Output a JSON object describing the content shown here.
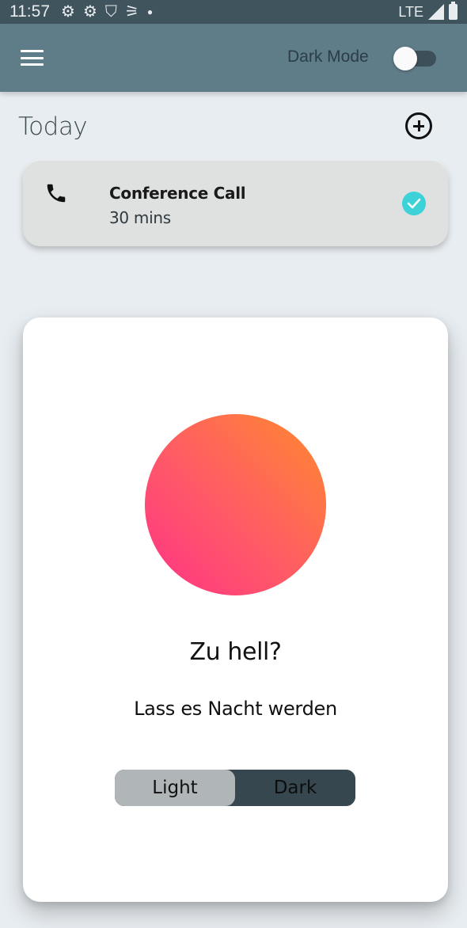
{
  "status_bar": {
    "time": "11:57",
    "icons": [
      "gear-icon",
      "gear-icon",
      "shield-icon",
      "satellite-icon",
      "dot-icon"
    ],
    "network": "LTE"
  },
  "app_bar": {
    "dark_mode_label": "Dark Mode",
    "dark_mode_enabled": false
  },
  "today": {
    "title": "Today"
  },
  "tasks": [
    {
      "title": "Conference Call",
      "duration": "30 mins",
      "icon": "phone-icon",
      "done": true
    }
  ],
  "dialog": {
    "title": "Zu hell?",
    "subtitle": "Lass es Nacht werden",
    "options": [
      "Light",
      "Dark"
    ],
    "selected": "Light",
    "circle_colors": [
      "#ff3385",
      "#ff8a2e"
    ]
  },
  "colors": {
    "app_bar": "#5f7c89",
    "status_bar": "#3f545d",
    "accent_check": "#3dd2d8",
    "background": "#e8edf1"
  }
}
